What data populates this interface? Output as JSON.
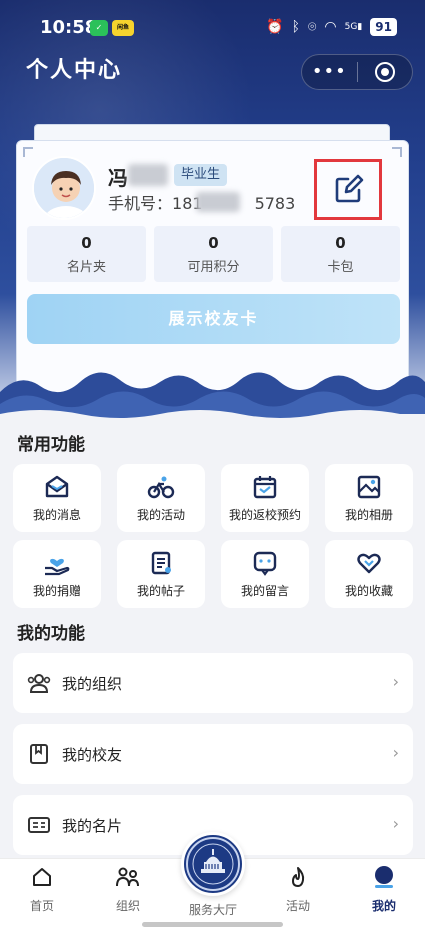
{
  "status_bar": {
    "time": "10:58",
    "app_icon_2": "闲鱼",
    "signal_label": "5G",
    "battery": "91"
  },
  "header": {
    "title": "个人中心",
    "more_label": "•••"
  },
  "profile": {
    "name_visible": "冯",
    "badge": "毕业生",
    "phone_label": "手机号：",
    "phone_prefix": "181",
    "phone_suffix": "5783"
  },
  "stats": [
    {
      "value": "0",
      "label": "名片夹"
    },
    {
      "value": "0",
      "label": "可用积分"
    },
    {
      "value": "0",
      "label": "卡包"
    }
  ],
  "show_card_button": "展示校友卡",
  "common_functions": {
    "title": "常用功能",
    "items": [
      {
        "label": "我的消息",
        "icon": "envelope-icon"
      },
      {
        "label": "我的活动",
        "icon": "bicycle-icon"
      },
      {
        "label": "我的返校预约",
        "icon": "calendar-check-icon"
      },
      {
        "label": "我的相册",
        "icon": "photo-album-icon"
      },
      {
        "label": "我的捐赠",
        "icon": "donation-hand-icon"
      },
      {
        "label": "我的帖子",
        "icon": "document-icon"
      },
      {
        "label": "我的留言",
        "icon": "message-bubble-icon"
      },
      {
        "label": "我的收藏",
        "icon": "heart-icon"
      }
    ]
  },
  "my_functions": {
    "title": "我的功能",
    "items": [
      {
        "label": "我的组织",
        "icon": "people-icon"
      },
      {
        "label": "我的校友",
        "icon": "bookmark-icon"
      },
      {
        "label": "我的名片",
        "icon": "id-card-icon"
      }
    ],
    "chevron": "›"
  },
  "tab_bar": {
    "tabs": [
      {
        "label": "首页",
        "icon": "home-icon"
      },
      {
        "label": "组织",
        "icon": "group-icon"
      },
      {
        "label": "服务大厅",
        "icon": "campus-emblem-icon"
      },
      {
        "label": "活动",
        "icon": "flame-icon"
      },
      {
        "label": "我的",
        "icon": "user-icon"
      }
    ],
    "active": "我的"
  },
  "colors": {
    "primary": "#1a2d6e",
    "highlight_border": "#e2383d",
    "button_gradient_start": "#9fd3f4"
  }
}
